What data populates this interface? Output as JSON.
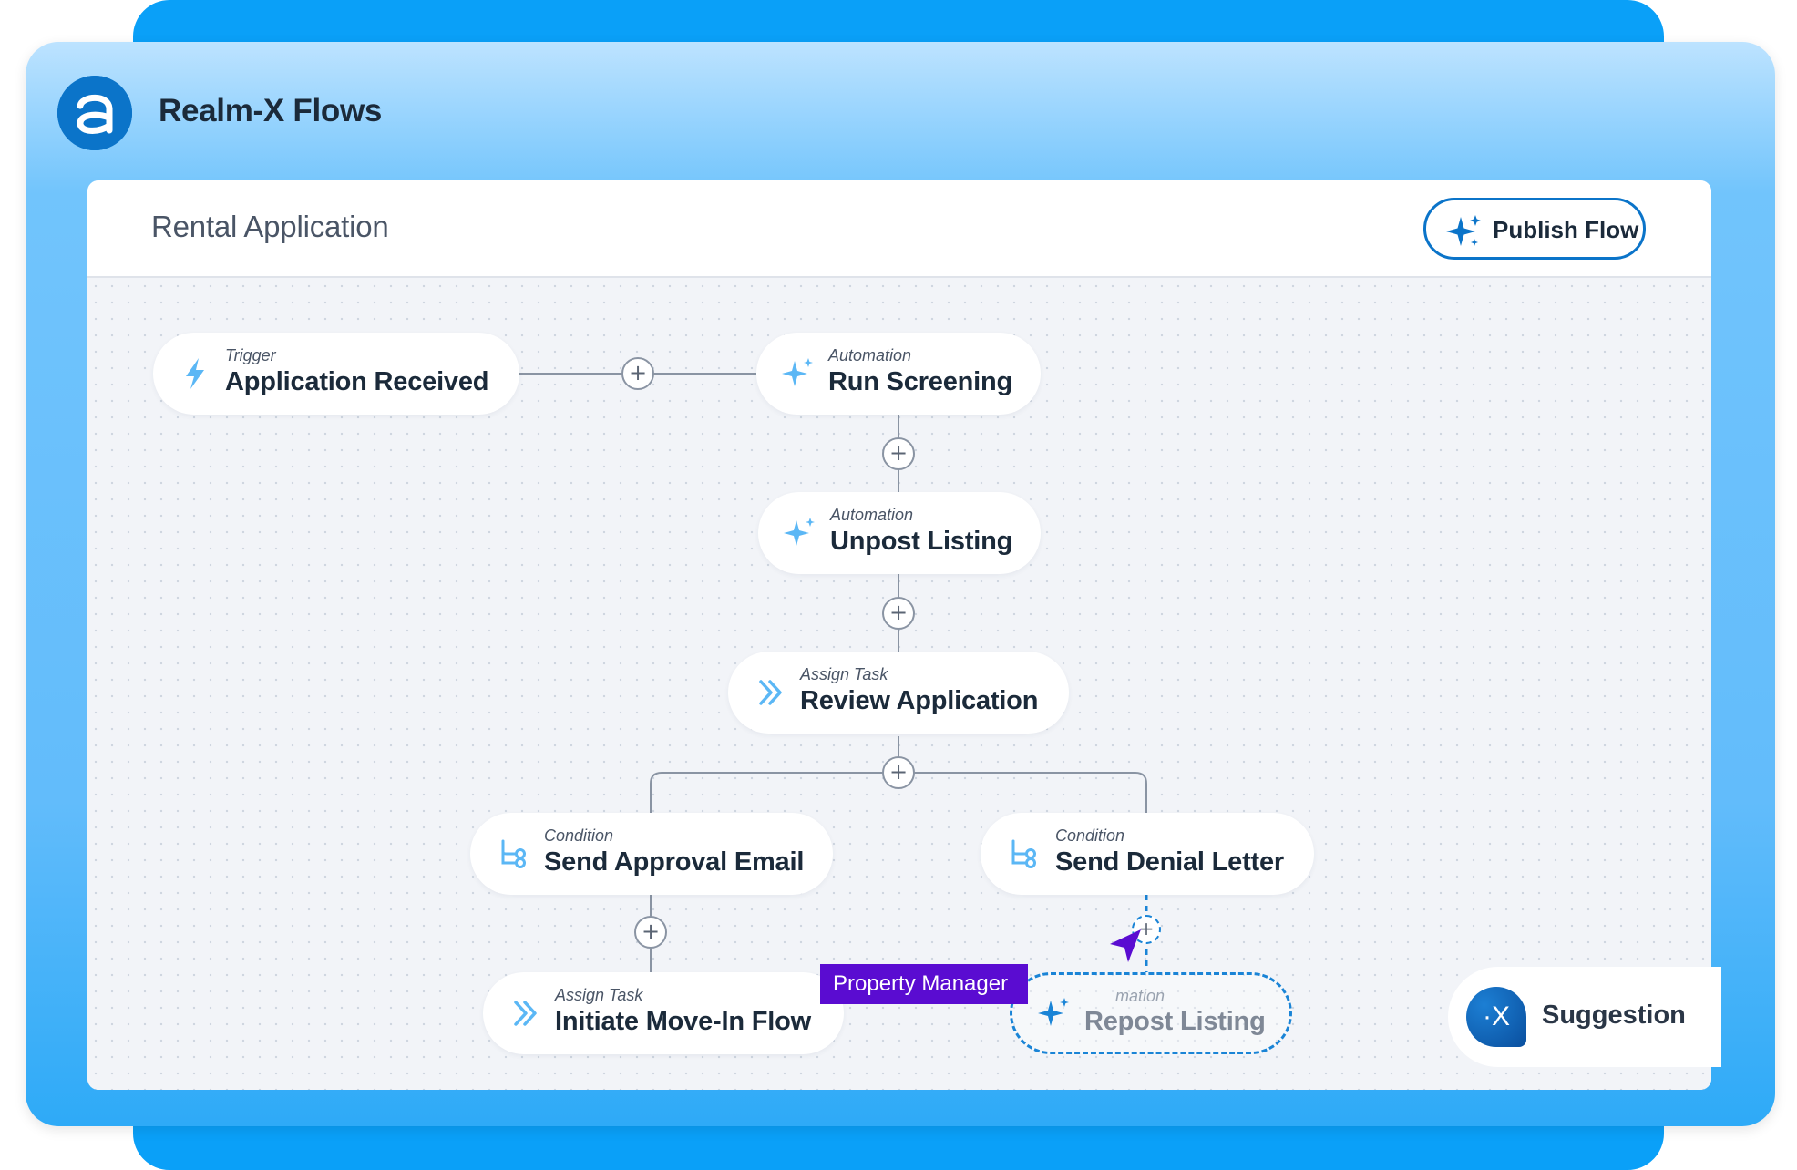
{
  "app": {
    "name": "Realm-X Flows",
    "logo_letter": "a"
  },
  "header": {
    "flow_title": "Rental Application",
    "publish_label": "Publish Flow"
  },
  "nodes": {
    "application_received": {
      "type": "Trigger",
      "title": "Application Received",
      "icon": "lightning-icon"
    },
    "run_screening": {
      "type": "Automation",
      "title": "Run Screening",
      "icon": "sparkle-icon"
    },
    "unpost_listing": {
      "type": "Automation",
      "title": "Unpost Listing",
      "icon": "sparkle-icon"
    },
    "review_application": {
      "type": "Assign Task",
      "title": "Review Application",
      "icon": "double-chevron-icon"
    },
    "send_approval_email": {
      "type": "Condition",
      "title": "Send Approval Email",
      "icon": "branch-icon"
    },
    "send_denial_letter": {
      "type": "Condition",
      "title": "Send Denial Letter",
      "icon": "branch-icon"
    },
    "initiate_move_in": {
      "type": "Assign Task",
      "title": "Initiate Move-In Flow",
      "icon": "double-chevron-icon"
    },
    "repost_listing": {
      "type": "mation",
      "title": "Repost Listing",
      "icon": "sparkle-icon",
      "state": "suggested"
    }
  },
  "add_button_symbol": "+",
  "collaborator_tag": "Property Manager",
  "suggestion": {
    "label": "Suggestion",
    "avatar_text": "·X"
  },
  "colors": {
    "brand_blue": "#0b74c9",
    "accent_light_blue": "#5bb7f5",
    "tag_purple": "#5a0cd1",
    "frame_blue": "#62bcfb"
  }
}
